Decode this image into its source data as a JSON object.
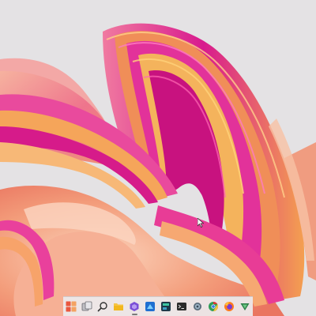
{
  "desktop": {
    "wallpaper": "abstract-pink-orange-waves",
    "colors": {
      "background": "#e3e1e3",
      "pink": "#e0379e",
      "magenta": "#c0168a",
      "orange": "#f09a4e",
      "peach": "#f3a384",
      "coral": "#ef7a6b"
    }
  },
  "taskbar": {
    "items": [
      {
        "name": "start-button",
        "icon": "windows-logo-icon",
        "active": false
      },
      {
        "name": "task-view-button",
        "icon": "task-view-icon",
        "active": false
      },
      {
        "name": "search-button",
        "icon": "search-icon",
        "active": false
      },
      {
        "name": "file-explorer-button",
        "icon": "folder-icon",
        "active": false
      },
      {
        "name": "app-button-1",
        "icon": "purple-app-icon",
        "active": true
      },
      {
        "name": "app-button-2",
        "icon": "blue-app-icon",
        "active": false
      },
      {
        "name": "app-button-3",
        "icon": "dark-app-icon",
        "active": false
      },
      {
        "name": "terminal-button",
        "icon": "terminal-icon",
        "active": false
      },
      {
        "name": "settings-button",
        "icon": "gear-icon",
        "active": false
      },
      {
        "name": "chrome-button",
        "icon": "chrome-icon",
        "active": false
      },
      {
        "name": "firefox-button",
        "icon": "firefox-icon",
        "active": false
      },
      {
        "name": "app-button-4",
        "icon": "green-app-icon",
        "active": false
      }
    ]
  }
}
